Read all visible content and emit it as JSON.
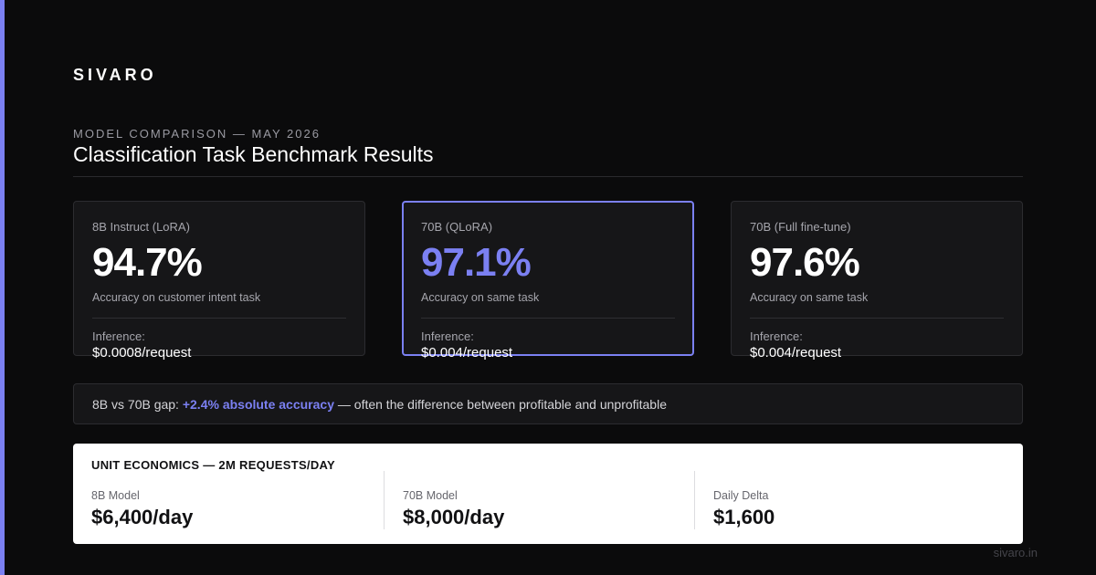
{
  "brand": "SIVARO",
  "header": {
    "eyebrow": "MODEL COMPARISON — MAY 2026",
    "title": "Classification Task Benchmark Results"
  },
  "cards": [
    {
      "label": "8B Instruct (LoRA)",
      "value": "94.7%",
      "description": "Accuracy on customer intent task",
      "inference_label": "Inference:",
      "inference_value": "$0.0008/request"
    },
    {
      "label": "70B (QLoRA)",
      "value": "97.1%",
      "description": "Accuracy on same task",
      "inference_label": "Inference:",
      "inference_value": "$0.004/request"
    },
    {
      "label": "70B (Full fine-tune)",
      "value": "97.6%",
      "description": "Accuracy on same task",
      "inference_label": "Inference:",
      "inference_value": "$0.004/request"
    }
  ],
  "gap": {
    "prefix": "8B vs 70B gap:",
    "highlight": "+2.4% absolute accuracy",
    "suffix": "— often the difference between profitable and unprofitable"
  },
  "economics": {
    "title": "UNIT ECONOMICS — 2M REQUESTS/DAY",
    "items": [
      {
        "label": "8B Model",
        "value": "$6,400/day"
      },
      {
        "label": "70B Model",
        "value": "$8,000/day"
      },
      {
        "label": "Daily Delta",
        "value": "$1,600"
      }
    ]
  },
  "footer": "sivaro.in",
  "colors": {
    "accent": "#7b80f2",
    "background": "#0b0b0c",
    "card": "#161618"
  }
}
